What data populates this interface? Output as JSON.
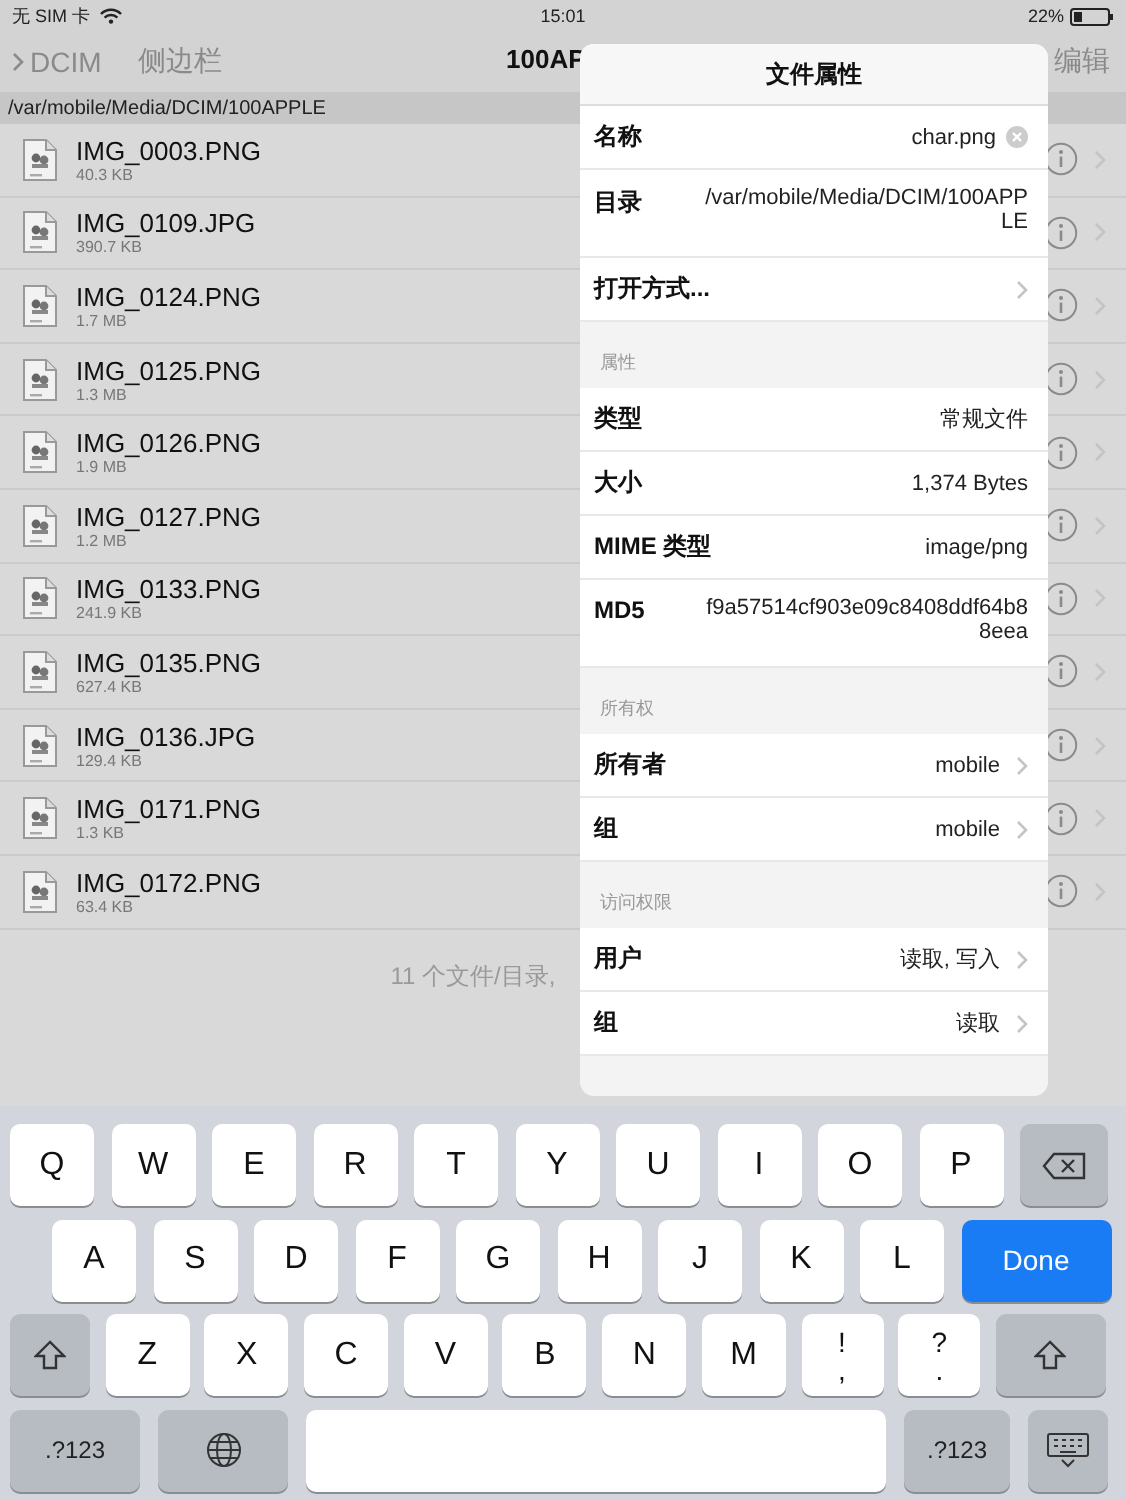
{
  "status_bar": {
    "carrier": "无 SIM 卡",
    "time": "15:01",
    "battery": "22%"
  },
  "nav": {
    "back": "DCIM",
    "sidebar": "侧边栏",
    "title": "100AP",
    "edit": "编辑"
  },
  "path": "/var/mobile/Media/DCIM/100APPLE",
  "files": [
    {
      "name": "IMG_0003.PNG",
      "size": "40.3 KB"
    },
    {
      "name": "IMG_0109.JPG",
      "size": "390.7 KB"
    },
    {
      "name": "IMG_0124.PNG",
      "size": "1.7 MB"
    },
    {
      "name": "IMG_0125.PNG",
      "size": "1.3 MB"
    },
    {
      "name": "IMG_0126.PNG",
      "size": "1.9 MB"
    },
    {
      "name": "IMG_0127.PNG",
      "size": "1.2 MB"
    },
    {
      "name": "IMG_0133.PNG",
      "size": "241.9 KB"
    },
    {
      "name": "IMG_0135.PNG",
      "size": "627.4 KB"
    },
    {
      "name": "IMG_0136.JPG",
      "size": "129.4 KB"
    },
    {
      "name": "IMG_0171.PNG",
      "size": "1.3 KB"
    },
    {
      "name": "IMG_0172.PNG",
      "size": "63.4 KB"
    }
  ],
  "footer": "11 个文件/目录,",
  "popover": {
    "title": "文件属性",
    "sections": [
      {
        "rows": [
          {
            "kind": "field",
            "label": "名称",
            "value": "char.png"
          },
          {
            "kind": "value",
            "label": "目录",
            "value": "/var/mobile/Media/DCIM/100APPLE"
          },
          {
            "kind": "link",
            "label": "打开方式..."
          }
        ]
      },
      {
        "header": "属性",
        "rows": [
          {
            "kind": "value",
            "label": "类型",
            "value": "常规文件"
          },
          {
            "kind": "value",
            "label": "大小",
            "value": "1,374 Bytes"
          },
          {
            "kind": "value",
            "label": "MIME 类型",
            "value": "image/png"
          },
          {
            "kind": "value",
            "label": "MD5",
            "value": "f9a57514cf903e09c8408ddf64b88eea"
          }
        ]
      },
      {
        "header": "所有权",
        "rows": [
          {
            "kind": "link",
            "label": "所有者",
            "value": "mobile"
          },
          {
            "kind": "link",
            "label": "组",
            "value": "mobile"
          }
        ]
      },
      {
        "header": "访问权限",
        "rows": [
          {
            "kind": "link",
            "label": "用户",
            "value": "读取, 写入"
          },
          {
            "kind": "link",
            "label": "组",
            "value": "读取"
          }
        ]
      }
    ]
  },
  "keyboard": [
    [
      {
        "kind": "letter",
        "label": "Q"
      },
      {
        "kind": "letter",
        "label": "W"
      },
      {
        "kind": "letter",
        "label": "E"
      },
      {
        "kind": "letter",
        "label": "R"
      },
      {
        "kind": "letter",
        "label": "T"
      },
      {
        "kind": "letter",
        "label": "Y"
      },
      {
        "kind": "letter",
        "label": "U"
      },
      {
        "kind": "letter",
        "label": "I"
      },
      {
        "kind": "letter",
        "label": "O"
      },
      {
        "kind": "letter",
        "label": "P"
      },
      {
        "kind": "delete"
      }
    ],
    [
      {
        "kind": "letter",
        "label": "A"
      },
      {
        "kind": "letter",
        "label": "S"
      },
      {
        "kind": "letter",
        "label": "D"
      },
      {
        "kind": "letter",
        "label": "F"
      },
      {
        "kind": "letter",
        "label": "G"
      },
      {
        "kind": "letter",
        "label": "H"
      },
      {
        "kind": "letter",
        "label": "J"
      },
      {
        "kind": "letter",
        "label": "K"
      },
      {
        "kind": "letter",
        "label": "L"
      },
      {
        "kind": "done",
        "label": "Done"
      }
    ],
    [
      {
        "kind": "shift"
      },
      {
        "kind": "letter",
        "label": "Z"
      },
      {
        "kind": "letter",
        "label": "X"
      },
      {
        "kind": "letter",
        "label": "C"
      },
      {
        "kind": "letter",
        "label": "V"
      },
      {
        "kind": "letter",
        "label": "B"
      },
      {
        "kind": "letter",
        "label": "N"
      },
      {
        "kind": "letter",
        "label": "M"
      },
      {
        "kind": "punct",
        "label": "!",
        "sub": ","
      },
      {
        "kind": "punct",
        "label": "?",
        "sub": "."
      },
      {
        "kind": "shift"
      }
    ],
    [
      {
        "kind": "mode",
        "label": ".?123"
      },
      {
        "kind": "globe"
      },
      {
        "kind": "space"
      },
      {
        "kind": "mode",
        "label": ".?123"
      },
      {
        "kind": "dismiss"
      }
    ]
  ]
}
